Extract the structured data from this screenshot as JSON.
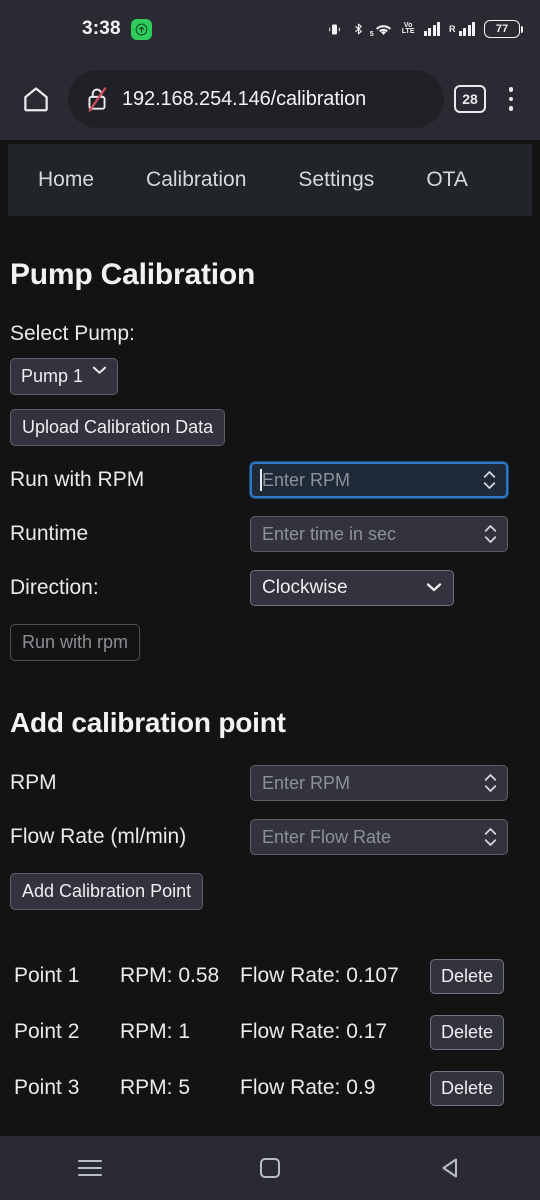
{
  "status_bar": {
    "time": "3:38",
    "recording_icon": "arrow-up-badge-icon",
    "icons": [
      "vibrate-icon",
      "bluetooth-icon",
      "wifi-5g-icon",
      "volte-icon",
      "signal-bars-icon",
      "roaming-signal-icon"
    ],
    "volte_top": "Vo",
    "volte_bottom": "LTE",
    "roaming_label": "R",
    "battery_percent": "77"
  },
  "browser": {
    "home_icon": "home-icon",
    "security_icon": "lock-crossed-out-icon",
    "url": "192.168.254.146/calibration",
    "tab_count": "28",
    "menu_icon": "kebab-menu-icon"
  },
  "site_nav": {
    "items": [
      {
        "label": "Home"
      },
      {
        "label": "Calibration"
      },
      {
        "label": "Settings"
      },
      {
        "label": "OTA"
      }
    ]
  },
  "calibration": {
    "title": "Pump Calibration",
    "select_pump_label": "Select Pump:",
    "pump_selected": "Pump 1",
    "pump_options": [
      "Pump 1"
    ],
    "upload_button": "Upload Calibration Data",
    "run_rpm_label": "Run with RPM",
    "run_rpm_placeholder": "Enter RPM",
    "run_rpm_value": "",
    "runtime_label": "Runtime",
    "runtime_placeholder": "Enter time in sec",
    "runtime_value": "",
    "direction_label": "Direction:",
    "direction_selected": "Clockwise",
    "direction_options": [
      "Clockwise"
    ],
    "run_button": "Run with rpm"
  },
  "add_point": {
    "title": "Add calibration point",
    "rpm_label": "RPM",
    "rpm_placeholder": "Enter RPM",
    "rpm_value": "",
    "flow_label": "Flow Rate (ml/min)",
    "flow_placeholder": "Enter Flow Rate",
    "flow_value": "",
    "add_button": "Add Calibration Point"
  },
  "points": [
    {
      "name": "Point 1",
      "rpm": "RPM: 0.58",
      "flow": "Flow Rate: 0.107",
      "delete": "Delete"
    },
    {
      "name": "Point 2",
      "rpm": "RPM: 1",
      "flow": "Flow Rate: 0.17",
      "delete": "Delete"
    },
    {
      "name": "Point 3",
      "rpm": "RPM: 5",
      "flow": "Flow Rate: 0.9",
      "delete": "Delete"
    }
  ],
  "android_nav": {
    "recents_icon": "recents-icon",
    "home_icon": "home-square-icon",
    "back_icon": "back-triangle-icon"
  },
  "colors": {
    "page_background": "#131313",
    "chrome_background": "#2a2b32",
    "nav_strip": "#212529",
    "control_background": "#32333c",
    "focus_blue": "#2f78c4",
    "accent_green": "#2ecc5a",
    "insecure_red": "#d04a5e"
  }
}
